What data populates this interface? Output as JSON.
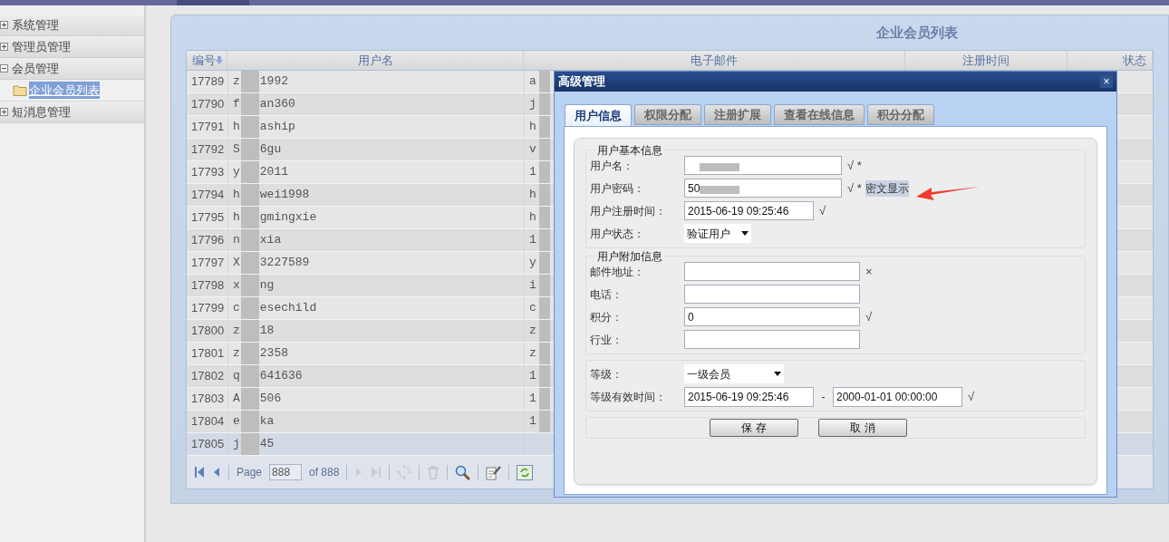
{
  "sidebar": {
    "items": [
      {
        "label": "系统管理",
        "expanded": false
      },
      {
        "label": "管理员管理",
        "expanded": false
      },
      {
        "label": "会员管理",
        "expanded": true,
        "children": [
          {
            "label": "企业会员列表",
            "selected": true
          }
        ]
      },
      {
        "label": "短消息管理",
        "expanded": false
      }
    ]
  },
  "panel": {
    "title": "企业会员列表"
  },
  "table": {
    "columns": [
      "编号",
      "用户名",
      "电子邮件",
      "注册时间",
      "状态"
    ],
    "rows": [
      {
        "id": "17789",
        "user_start": "z",
        "user_end": "1992",
        "email_start": "a",
        "selected": false
      },
      {
        "id": "17790",
        "user_start": "f",
        "user_end": "an360",
        "email_start": "j",
        "selected": false
      },
      {
        "id": "17791",
        "user_start": "h",
        "user_end": "aship",
        "email_start": "h",
        "selected": false
      },
      {
        "id": "17792",
        "user_start": "S",
        "user_end": "6gu",
        "email_start": "v",
        "selected": false
      },
      {
        "id": "17793",
        "user_start": "y",
        "user_end": "2011",
        "email_start": "1",
        "selected": false
      },
      {
        "id": "17794",
        "user_start": "h",
        "user_end": "wei1998",
        "email_start": "h",
        "selected": false
      },
      {
        "id": "17795",
        "user_start": "h",
        "user_end": "gmingxie",
        "email_start": "h",
        "selected": false
      },
      {
        "id": "17796",
        "user_start": "n",
        "user_end": "xia",
        "email_start": "1",
        "selected": false
      },
      {
        "id": "17797",
        "user_start": "X",
        "user_end": "3227589",
        "email_start": "y",
        "selected": false
      },
      {
        "id": "17798",
        "user_start": "x",
        "user_end": "ng",
        "email_start": "i",
        "selected": false
      },
      {
        "id": "17799",
        "user_start": "c",
        "user_end": "esechild",
        "email_start": "c",
        "selected": false
      },
      {
        "id": "17800",
        "user_start": "z",
        "user_end": "18",
        "email_start": "z",
        "selected": false
      },
      {
        "id": "17801",
        "user_start": "z",
        "user_end": "2358",
        "email_start": "z",
        "selected": false
      },
      {
        "id": "17802",
        "user_start": "q",
        "user_end": "641636",
        "email_start": "1",
        "selected": false
      },
      {
        "id": "17803",
        "user_start": "A",
        "user_end": "506",
        "email_start": "1",
        "selected": false
      },
      {
        "id": "17804",
        "user_start": "e",
        "user_end": "ka",
        "email_start": "1",
        "selected": false
      },
      {
        "id": "17805",
        "user_start": "j",
        "user_end": "45",
        "selected": true
      }
    ]
  },
  "pager": {
    "page_label": "Page",
    "page_value": "888",
    "of_label": "of 888"
  },
  "dialog": {
    "title": "高级管理",
    "close": "×",
    "tabs": [
      {
        "label": "用户信息",
        "selected": true
      },
      {
        "label": "权限分配",
        "selected": false
      },
      {
        "label": "注册扩展",
        "selected": false
      },
      {
        "label": "查看在线信息",
        "selected": false
      },
      {
        "label": "积分分配",
        "selected": false
      }
    ],
    "basic": {
      "legend": "用户基本信息",
      "fields": [
        {
          "kind": "text",
          "label": "用户名：",
          "redacted": true,
          "marks": "√ *"
        },
        {
          "kind": "text",
          "label": "用户密码：",
          "value": "50",
          "redacted": true,
          "marks": "√ *",
          "link": "密文显示"
        },
        {
          "kind": "date",
          "label": "用户注册时间：",
          "value": "2015-06-19 09:25:46",
          "marks": "√"
        },
        {
          "kind": "select",
          "label": "用户状态：",
          "value": "验证用户"
        }
      ]
    },
    "extra": {
      "legend": "用户附加信息",
      "fields": [
        {
          "kind": "text",
          "label": "邮件地址：",
          "marks": "×"
        },
        {
          "kind": "text",
          "label": "电话："
        },
        {
          "kind": "text",
          "label": "积分：",
          "value": "0",
          "marks": "√"
        },
        {
          "kind": "text",
          "label": "行业："
        }
      ]
    },
    "level": {
      "label": "等级：",
      "value": "一级会员"
    },
    "validity": {
      "label": "等级有效时间：",
      "from": "2015-06-19 09:25:46",
      "dash": "-",
      "to": "2000-01-01 00:00:00",
      "marks": "√"
    },
    "buttons": [
      "保 存",
      "取 消"
    ]
  }
}
